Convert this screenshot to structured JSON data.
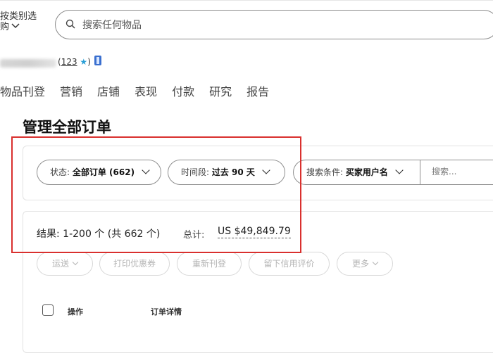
{
  "header": {
    "category_select": {
      "line1": "按类别选",
      "line2": "购",
      "chevron_icon": "chevron-down-icon"
    },
    "search": {
      "placeholder": "搜索任何物品",
      "icon": "search-icon"
    }
  },
  "account": {
    "feedback_open": "(",
    "feedback_score": "123",
    "star_icon": "★",
    "feedback_close": ")"
  },
  "nav": {
    "items": [
      "物品刊登",
      "营销",
      "店铺",
      "表现",
      "付款",
      "研究",
      "报告"
    ]
  },
  "page": {
    "title": "管理全部订单"
  },
  "filters": {
    "status": {
      "label": "状态:",
      "value": "全部订单 (662)"
    },
    "period": {
      "label": "时间段:",
      "value": "过去 90 天"
    },
    "search_by": {
      "label": "搜索条件:",
      "value": "买家用户名"
    },
    "keyword": {
      "placeholder": "搜索..."
    }
  },
  "summary": {
    "results": "结果: 1-200 个 (共 662 个)",
    "total_label": "总计:",
    "total_value": "US $49,849.79"
  },
  "actions": [
    "运送",
    "打印优惠券",
    "重新刊登",
    "留下信用评价",
    "更多"
  ],
  "table": {
    "headers": [
      "操作",
      "订单详情"
    ]
  },
  "colors": {
    "highlight_border": "#d9302e",
    "star": "#2a9fd6"
  }
}
